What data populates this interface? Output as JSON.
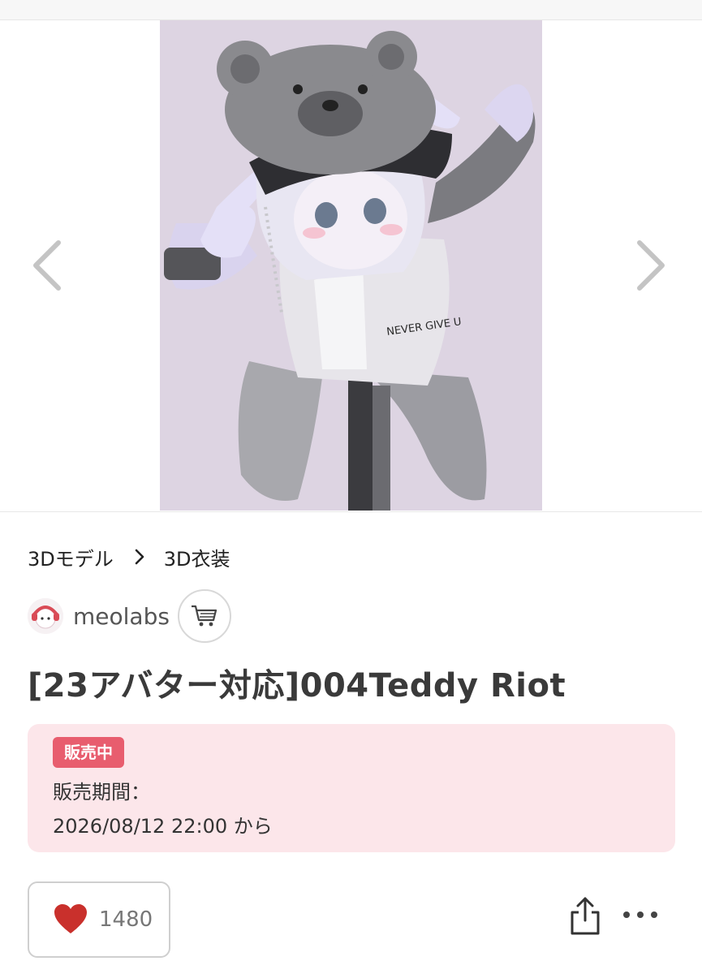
{
  "gallery": {
    "prev_icon": "chevron-left-icon",
    "next_icon": "chevron-right-icon",
    "image_text": "NEVER GIVE U"
  },
  "breadcrumb": {
    "items": [
      "3Dモデル",
      "3D衣装"
    ],
    "separator_icon": "chevron-right-icon"
  },
  "shop": {
    "name": "meolabs",
    "cart_icon": "shopping-cart-icon"
  },
  "product": {
    "title": "[23アバター対応]004Teddy Riot"
  },
  "sale": {
    "badge": "販売中",
    "period_label": "販売期間：",
    "period_value": "2026/08/12 22:00 から"
  },
  "actions": {
    "like_count": "1480",
    "like_icon": "heart-icon",
    "share_icon": "share-icon",
    "more_icon": "more-horizontal-icon"
  },
  "colors": {
    "accent": "#e85d6e",
    "sale_bg": "#fce6ea",
    "heart": "#c9302c",
    "image_bg": "#ddd4e2"
  }
}
